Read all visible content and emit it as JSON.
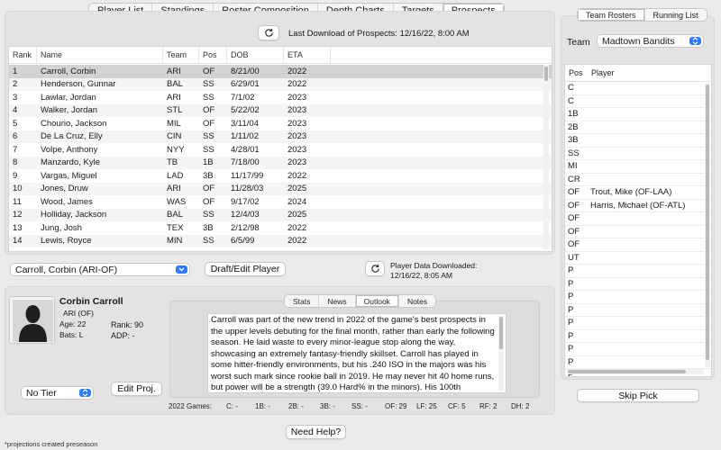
{
  "tabs": [
    "Player List",
    "Standings",
    "Roster Composition",
    "Depth Charts",
    "Targets",
    "Prospects"
  ],
  "active_tab": "Prospects",
  "last_download": "Last Download of Prospects: 12/16/22, 8:00 AM",
  "columns": [
    "Rank",
    "Name",
    "Team",
    "Pos",
    "DOB",
    "ETA"
  ],
  "prospects": [
    {
      "rank": "1",
      "name": "Carroll, Corbin",
      "team": "ARI",
      "pos": "OF",
      "dob": "8/21/00",
      "eta": "2022"
    },
    {
      "rank": "2",
      "name": "Henderson, Gunnar",
      "team": "BAL",
      "pos": "SS",
      "dob": "6/29/01",
      "eta": "2022"
    },
    {
      "rank": "3",
      "name": "Lawlar, Jordan",
      "team": "ARI",
      "pos": "SS",
      "dob": "7/1/02",
      "eta": "2023"
    },
    {
      "rank": "4",
      "name": "Walker, Jordan",
      "team": "STL",
      "pos": "OF",
      "dob": "5/22/02",
      "eta": "2023"
    },
    {
      "rank": "5",
      "name": "Chourio, Jackson",
      "team": "MIL",
      "pos": "OF",
      "dob": "3/11/04",
      "eta": "2023"
    },
    {
      "rank": "6",
      "name": "De La Cruz, Elly",
      "team": "CIN",
      "pos": "SS",
      "dob": "1/11/02",
      "eta": "2023"
    },
    {
      "rank": "7",
      "name": "Volpe, Anthony",
      "team": "NYY",
      "pos": "SS",
      "dob": "4/28/01",
      "eta": "2023"
    },
    {
      "rank": "8",
      "name": "Manzardo, Kyle",
      "team": "TB",
      "pos": "1B",
      "dob": "7/18/00",
      "eta": "2023"
    },
    {
      "rank": "9",
      "name": "Vargas, Miguel",
      "team": "LAD",
      "pos": "3B",
      "dob": "11/17/99",
      "eta": "2022"
    },
    {
      "rank": "10",
      "name": "Jones, Druw",
      "team": "ARI",
      "pos": "OF",
      "dob": "11/28/03",
      "eta": "2025"
    },
    {
      "rank": "11",
      "name": "Wood, James",
      "team": "WAS",
      "pos": "OF",
      "dob": "9/17/02",
      "eta": "2024"
    },
    {
      "rank": "12",
      "name": "Holliday, Jackson",
      "team": "BAL",
      "pos": "SS",
      "dob": "12/4/03",
      "eta": "2025"
    },
    {
      "rank": "13",
      "name": "Jung, Josh",
      "team": "TEX",
      "pos": "3B",
      "dob": "2/12/98",
      "eta": "2022"
    },
    {
      "rank": "14",
      "name": "Lewis, Royce",
      "team": "MIN",
      "pos": "SS",
      "dob": "6/5/99",
      "eta": "2022"
    }
  ],
  "player_select": "Carroll, Corbin (ARI-OF)",
  "draft_edit_button": "Draft/Edit Player",
  "player_data_downloaded": "Player Data Downloaded:",
  "player_data_date": "12/16/22, 8:05 AM",
  "player": {
    "name": "Corbin Carroll",
    "team_pos": "ARI (OF)",
    "age": "Age: 22",
    "bats": "Bats: L",
    "rank": "Rank: 90",
    "adp": "ADP: -"
  },
  "detail_tabs": [
    "Stats",
    "News",
    "Outlook",
    "Notes"
  ],
  "active_detail_tab": "Outlook",
  "outlook_text": "Carroll was part of the new trend in 2022 of the game's best prospects in the upper levels debuting for the final month, rather than early the following season. He laid waste to every minor-league stop along the way, showcasing an extremely fantasy-friendly skillset. Carroll has played in some hitter-friendly environments, but his .240 ISO in the majors was his worst such mark since rookie ball in 2019. He may never hit 40 home runs, but power will be a strength (39.0 Hard% in the minors). His 100th",
  "tier_select": "No Tier",
  "edit_proj_button": "Edit Proj.",
  "games_label": "2022 Games:",
  "games": [
    "C: -",
    "1B: -",
    "2B: -",
    "3B: -",
    "SS: -",
    "OF: 29",
    "LF: 25",
    "CF: 5",
    "RF: 2",
    "DH: 2"
  ],
  "help_button": "Need Help?",
  "footnote": "*projections created preseason",
  "right_tabs": [
    "Team Rosters",
    "Running List"
  ],
  "active_right_tab": "Team Rosters",
  "team_label": "Team",
  "team_select": "Madtown Bandits",
  "roster_columns": [
    "Pos",
    "Player"
  ],
  "roster": [
    {
      "pos": "C",
      "player": ""
    },
    {
      "pos": "C",
      "player": ""
    },
    {
      "pos": "1B",
      "player": ""
    },
    {
      "pos": "2B",
      "player": ""
    },
    {
      "pos": "3B",
      "player": ""
    },
    {
      "pos": "SS",
      "player": ""
    },
    {
      "pos": "MI",
      "player": ""
    },
    {
      "pos": "CR",
      "player": ""
    },
    {
      "pos": "OF",
      "player": "Trout, Mike (OF-LAA)"
    },
    {
      "pos": "OF",
      "player": "Harris, Michael (OF-ATL)"
    },
    {
      "pos": "OF",
      "player": ""
    },
    {
      "pos": "OF",
      "player": ""
    },
    {
      "pos": "OF",
      "player": ""
    },
    {
      "pos": "UT",
      "player": ""
    },
    {
      "pos": "P",
      "player": ""
    },
    {
      "pos": "P",
      "player": ""
    },
    {
      "pos": "P",
      "player": ""
    },
    {
      "pos": "P",
      "player": ""
    },
    {
      "pos": "P",
      "player": ""
    },
    {
      "pos": "P",
      "player": ""
    },
    {
      "pos": "P",
      "player": ""
    },
    {
      "pos": "P",
      "player": ""
    },
    {
      "pos": "P",
      "player": ""
    }
  ],
  "skip_pick_button": "Skip Pick",
  "colors": {
    "accent": "#2f7bf5",
    "selected_row": "#d2d2d2",
    "panel": "#e4e3e2"
  }
}
